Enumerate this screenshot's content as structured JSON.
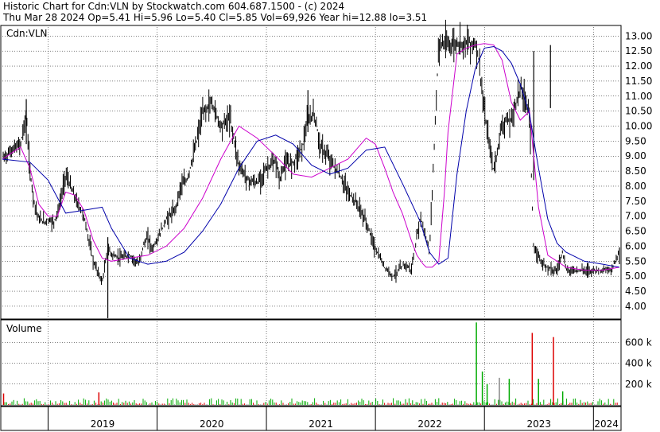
{
  "header": {
    "line1": "Historic Chart for Cdn:VLN by Stockwatch.com 604.687.1500 - (c) 2024",
    "line2": "Thu Mar 28 2024  Op=5.41  Hi=5.96  Lo=5.40  Cl=5.85  Vol=69,926  Year hi=12.88  lo=3.51"
  },
  "colors": {
    "price_bars": "#000000",
    "ma_short": "#cc00cc",
    "ma_long": "#0000aa",
    "volume_up": "#00aa00",
    "volume_down": "#dd0000",
    "volume_flat": "#888888",
    "grid": "#000000",
    "background": "#ffffff"
  },
  "chart_data": [
    {
      "type": "line",
      "title": "",
      "label": "Cdn:VLN",
      "grid": true,
      "ylim": [
        3.6,
        13.3
      ],
      "y_ticks": [
        "13.00",
        "12.50",
        "12.00",
        "11.50",
        "11.00",
        "10.50",
        "10.00",
        "9.50",
        "9.00",
        "8.50",
        "8.00",
        "7.50",
        "7.00",
        "6.50",
        "6.00",
        "5.50",
        "5.00",
        "4.50",
        "4.00"
      ],
      "x_ticks": [
        "2019",
        "2020",
        "2021",
        "2022",
        "2023",
        "2024"
      ],
      "x_tick_dates": [
        "2019-01-01",
        "2020-01-01",
        "2021-01-01",
        "2022-01-01",
        "2023-01-01",
        "2024-01-01"
      ],
      "xlim": [
        "2018-08-01",
        "2024-03-28"
      ],
      "series": [
        {
          "role": "price_close",
          "x": [
            "2018-08-01",
            "2018-09-01",
            "2018-10-01",
            "2018-10-20",
            "2018-11-01",
            "2018-11-15",
            "2018-12-01",
            "2018-12-20",
            "2019-01-01",
            "2019-01-20",
            "2019-02-05",
            "2019-03-01",
            "2019-04-01",
            "2019-05-01",
            "2019-06-01",
            "2019-07-01",
            "2019-07-20",
            "2019-08-05",
            "2019-09-01",
            "2019-10-01",
            "2019-11-01",
            "2019-11-15",
            "2019-12-01",
            "2019-12-15",
            "2020-01-01",
            "2020-02-01",
            "2020-03-01",
            "2020-03-20",
            "2020-04-10",
            "2020-05-01",
            "2020-06-01",
            "2020-07-01",
            "2020-08-01",
            "2020-09-01",
            "2020-10-01",
            "2020-11-01",
            "2020-12-01",
            "2021-01-01",
            "2021-02-01",
            "2021-02-15",
            "2021-03-01",
            "2021-04-01",
            "2021-05-01",
            "2021-05-20",
            "2021-06-10",
            "2021-07-01",
            "2021-08-01",
            "2021-09-01",
            "2021-10-01",
            "2021-11-01",
            "2021-12-01",
            "2022-01-01",
            "2022-02-01",
            "2022-03-01",
            "2022-03-20",
            "2022-04-10",
            "2022-05-01",
            "2022-06-01",
            "2022-07-01",
            "2022-08-01",
            "2022-09-01",
            "2022-10-01",
            "2022-11-01",
            "2022-11-25",
            "2022-12-01",
            "2022-12-10",
            "2023-01-01",
            "2023-02-01",
            "2023-03-01",
            "2023-04-01",
            "2023-05-01",
            "2023-06-01",
            "2023-06-15",
            "2023-07-01",
            "2023-07-15",
            "2023-08-01",
            "2023-08-10",
            "2023-08-20",
            "2023-09-01",
            "2023-09-20",
            "2023-10-01",
            "2023-11-01",
            "2023-12-01",
            "2024-01-01",
            "2024-02-01",
            "2024-03-01",
            "2024-03-28"
          ],
          "y": [
            8.9,
            9.2,
            9.4,
            10.4,
            8.5,
            7.5,
            6.9,
            6.8,
            6.9,
            6.8,
            7.2,
            8.4,
            7.6,
            7.0,
            5.5,
            4.8,
            5.9,
            5.7,
            5.6,
            5.7,
            5.4,
            6.0,
            6.3,
            5.9,
            6.2,
            6.9,
            7.2,
            8.0,
            8.2,
            9.0,
            10.4,
            10.8,
            10.0,
            10.3,
            8.7,
            8.2,
            8.1,
            8.6,
            8.8,
            8.2,
            8.7,
            8.8,
            9.3,
            10.2,
            10.4,
            9.3,
            8.9,
            8.4,
            7.8,
            7.4,
            6.8,
            5.9,
            5.3,
            5.0,
            5.2,
            5.4,
            5.2,
            7.0,
            5.8,
            12.75,
            12.7,
            12.75,
            12.8,
            12.75,
            12.7,
            12.5,
            10.4,
            8.5,
            10.1,
            10.2,
            11.3,
            10.5,
            5.8,
            5.7,
            5.4,
            5.3,
            5.3,
            5.2,
            5.2,
            5.85,
            5.2,
            5.2,
            5.2,
            5.2,
            5.2,
            5.2,
            5.85
          ]
        },
        {
          "role": "moving_average_short",
          "x": [
            "2018-08-01",
            "2018-10-01",
            "2018-11-01",
            "2018-12-01",
            "2019-01-01",
            "2019-02-01",
            "2019-03-01",
            "2019-04-01",
            "2019-05-01",
            "2019-06-01",
            "2019-07-01",
            "2019-08-01",
            "2019-10-01",
            "2019-12-01",
            "2020-02-01",
            "2020-04-01",
            "2020-06-01",
            "2020-08-01",
            "2020-10-01",
            "2020-12-01",
            "2021-02-01",
            "2021-04-01",
            "2021-06-01",
            "2021-08-01",
            "2021-10-01",
            "2021-12-01",
            "2022-01-01",
            "2022-02-01",
            "2022-03-01",
            "2022-04-01",
            "2022-05-01",
            "2022-05-20",
            "2022-06-10",
            "2022-06-20",
            "2022-07-10",
            "2022-08-01",
            "2022-08-20",
            "2022-09-01",
            "2022-10-01",
            "2022-11-01",
            "2022-12-01",
            "2023-01-01",
            "2023-02-01",
            "2023-03-01",
            "2023-04-01",
            "2023-05-01",
            "2023-06-01",
            "2023-07-01",
            "2023-08-01",
            "2023-09-01",
            "2023-10-01",
            "2023-12-01",
            "2024-02-01",
            "2024-03-28"
          ],
          "y": [
            8.9,
            9.3,
            8.6,
            7.4,
            7.0,
            7.0,
            7.8,
            7.7,
            7.2,
            6.2,
            5.6,
            5.5,
            5.6,
            5.7,
            6.0,
            6.6,
            7.6,
            8.9,
            10.0,
            9.6,
            9.0,
            8.4,
            8.3,
            8.6,
            8.9,
            9.6,
            9.4,
            8.6,
            7.8,
            7.1,
            6.2,
            5.7,
            5.4,
            5.3,
            5.3,
            5.5,
            7.8,
            9.8,
            12.4,
            12.6,
            12.7,
            12.75,
            12.7,
            12.2,
            10.8,
            10.2,
            10.5,
            7.3,
            5.7,
            5.5,
            5.3,
            5.2,
            5.2,
            5.3
          ]
        },
        {
          "role": "moving_average_long",
          "x": [
            "2018-08-01",
            "2018-11-01",
            "2019-01-01",
            "2019-03-01",
            "2019-05-01",
            "2019-07-01",
            "2019-08-01",
            "2019-10-01",
            "2019-12-01",
            "2020-02-01",
            "2020-04-01",
            "2020-06-01",
            "2020-08-01",
            "2020-10-01",
            "2020-12-01",
            "2021-02-01",
            "2021-04-01",
            "2021-06-01",
            "2021-08-01",
            "2021-10-01",
            "2021-12-01",
            "2022-02-01",
            "2022-04-01",
            "2022-06-01",
            "2022-07-01",
            "2022-08-01",
            "2022-09-01",
            "2022-10-01",
            "2022-11-01",
            "2022-12-01",
            "2023-01-01",
            "2023-02-01",
            "2023-03-01",
            "2023-04-01",
            "2023-05-01",
            "2023-06-01",
            "2023-07-01",
            "2023-08-01",
            "2023-09-01",
            "2023-10-01",
            "2023-12-01",
            "2024-02-01",
            "2024-03-28"
          ],
          "y": [
            8.9,
            8.8,
            8.2,
            7.1,
            7.2,
            7.3,
            6.6,
            5.6,
            5.4,
            5.5,
            5.8,
            6.5,
            7.4,
            8.6,
            9.5,
            9.7,
            9.4,
            8.7,
            8.4,
            8.6,
            9.2,
            9.3,
            8.1,
            6.8,
            5.8,
            5.4,
            5.6,
            8.4,
            10.5,
            11.9,
            12.6,
            12.65,
            12.5,
            12.1,
            11.4,
            10.4,
            8.6,
            6.9,
            6.1,
            5.8,
            5.5,
            5.4,
            5.3
          ]
        }
      ]
    },
    {
      "type": "bar",
      "title": "Volume",
      "grid": true,
      "ylim": [
        0,
        800000
      ],
      "y_ticks": [
        "600 k",
        "400 k",
        "200 k"
      ],
      "series": [
        {
          "role": "volume_spikes",
          "x": [
            "2018-08-05",
            "2019-06-20",
            "2022-12-05",
            "2022-12-25",
            "2023-01-10",
            "2023-02-20",
            "2023-03-25",
            "2023-06-10",
            "2023-07-01",
            "2023-08-20",
            "2023-09-20"
          ],
          "y": [
            110000,
            120000,
            790000,
            320000,
            200000,
            260000,
            250000,
            690000,
            250000,
            650000,
            130000
          ],
          "direction": [
            "down",
            "down",
            "up",
            "up",
            "up",
            "flat",
            "up",
            "down",
            "up",
            "down",
            "up"
          ]
        }
      ]
    }
  ]
}
